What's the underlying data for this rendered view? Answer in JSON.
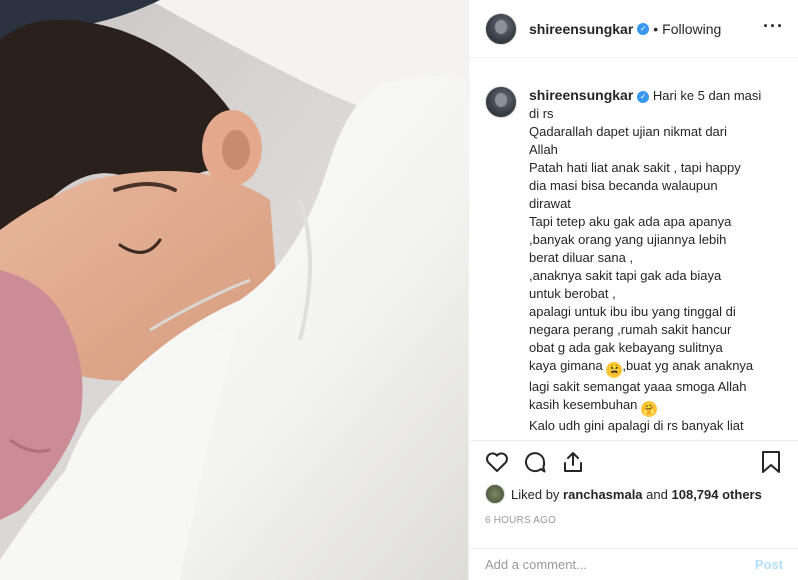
{
  "post": {
    "username": "shireensungkar",
    "verified": true,
    "follow_status": "Following",
    "more_icon": "more-options-icon",
    "caption_lines": [
      "Hari ke 5 dan masi",
      "di rs",
      "Qadarallah dapet ujian nikmat dari",
      "Allah",
      "Patah hati liat anak sakit , tapi happy",
      "dia masi bisa becanda walaupun",
      "dirawat",
      "Tapi tetep aku gak ada apa apanya",
      ",banyak orang yang ujiannya lebih",
      "berat diluar sana ,",
      ",anaknya sakit tapi gak ada biaya",
      "untuk berobat ,",
      "apalagi untuk ibu ibu yang tinggal di",
      "negara perang ,rumah sakit hancur",
      "obat g ada gak kebayang sulitnya",
      "kaya gimana",
      ",buat yg anak anaknya",
      "lagi sakit semangat yaaa smoga Allah",
      "kasih kesembuhan",
      "Kalo udh gini apalagi di rs banyak liat"
    ],
    "liked_by_prefix": "Liked by",
    "liked_by_user": "ranchasmala",
    "liked_by_and": "and",
    "likes_others": "108,794 others",
    "timestamp": "6 HOURS AGO",
    "comment_placeholder": "Add a comment...",
    "post_button": "Post"
  },
  "colors": {
    "verified_blue": "#3897f0",
    "post_button": "#b2dffc",
    "muted_text": "#999999"
  },
  "icons": [
    "heart-icon",
    "comment-icon",
    "share-icon",
    "bookmark-icon"
  ]
}
